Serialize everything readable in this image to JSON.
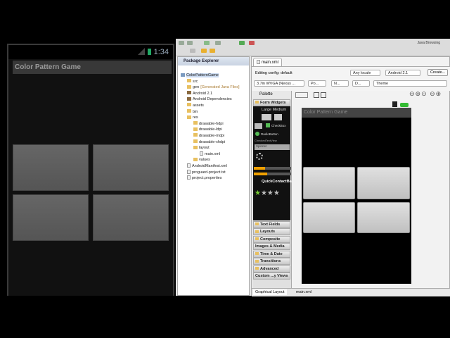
{
  "emulator": {
    "time": "1:34",
    "app_title": "Color Pattern Game"
  },
  "toolbar": {
    "perspective": "Java Browsing"
  },
  "package_explorer": {
    "title": "Package Explorer",
    "items": [
      {
        "label": "ColorPatternGame",
        "depth": 0,
        "type": "project"
      },
      {
        "label": "src",
        "depth": 1,
        "type": "folder"
      },
      {
        "label": "gen",
        "suffix": "[Generated Java Files]",
        "depth": 1,
        "type": "folder"
      },
      {
        "label": "Android 2.1",
        "depth": 1,
        "type": "lib"
      },
      {
        "label": "Android Dependencies",
        "depth": 1,
        "type": "lib"
      },
      {
        "label": "assets",
        "depth": 1,
        "type": "folder"
      },
      {
        "label": "bin",
        "depth": 1,
        "type": "folder"
      },
      {
        "label": "res",
        "depth": 1,
        "type": "folder"
      },
      {
        "label": "drawable-hdpi",
        "depth": 2,
        "type": "folder"
      },
      {
        "label": "drawable-ldpi",
        "depth": 2,
        "type": "folder"
      },
      {
        "label": "drawable-mdpi",
        "depth": 2,
        "type": "folder"
      },
      {
        "label": "drawable-xhdpi",
        "depth": 2,
        "type": "folder"
      },
      {
        "label": "layout",
        "depth": 2,
        "type": "folder"
      },
      {
        "label": "main.xml",
        "depth": 3,
        "type": "file"
      },
      {
        "label": "values",
        "depth": 2,
        "type": "folder"
      },
      {
        "label": "AndroidManifest.xml",
        "depth": 1,
        "type": "file"
      },
      {
        "label": "proguard-project.txt",
        "depth": 1,
        "type": "file"
      },
      {
        "label": "project.properties",
        "depth": 1,
        "type": "file"
      }
    ]
  },
  "editor": {
    "tab": "main.xml",
    "config_label": "Editing config:",
    "config_value": "default",
    "locale": "Any locale",
    "target": "Android 2.1",
    "create": "Create...",
    "device": "3.7in WVGA (Nexus ...",
    "orientation": "Po...",
    "dock": "N...",
    "night": "D...",
    "theme": "Theme",
    "palette_title": "Palette",
    "form_widgets": "Form Widgets",
    "pw_sizes": "Large  Medium",
    "pw_checkbox": "CheckBox",
    "pw_radio": "RadioButton",
    "pw_checked": "CheckedTextView",
    "pw_spinner": "Spinner",
    "pw_qcb": "QuickContactBa",
    "categories": [
      "Text Fields",
      "Layouts",
      "Composite",
      "Images & Media",
      "Time & Date",
      "Transitions",
      "Advanced",
      "Custom ...y Views"
    ],
    "preview_title": "Color Pattern Game",
    "bottom_tabs": [
      "Graphical Layout",
      "main.xml"
    ]
  }
}
